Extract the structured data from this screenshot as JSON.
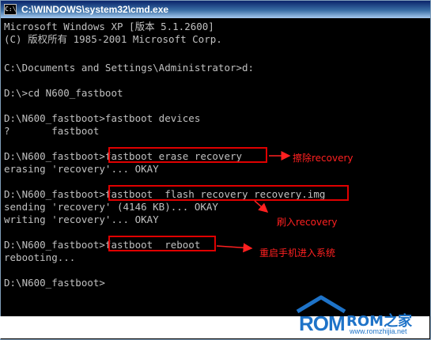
{
  "window": {
    "title": "C:\\WINDOWS\\system32\\cmd.exe",
    "icon": "console-icon",
    "icon_text": "C:\\"
  },
  "console": {
    "lines": [
      "Microsoft Windows XP [版本 5.1.2600]",
      "(C) 版权所有 1985-2001 Microsoft Corp.",
      "",
      "C:\\Documents and Settings\\Administrator>d:",
      "",
      "D:\\>cd N600_fastboot",
      "",
      "D:\\N600_fastboot>fastboot devices",
      "?       fastboot",
      "",
      "D:\\N600_fastboot>fastboot erase recovery",
      "erasing 'recovery'... OKAY",
      "",
      "D:\\N600_fastboot>fastboot  flash recovery recovery.img",
      "sending 'recovery' (4146 KB)... OKAY",
      "writing 'recovery'... OKAY",
      "",
      "D:\\N600_fastboot>fastboot  reboot",
      "rebooting...",
      "",
      "D:\\N600_fastboot>"
    ]
  },
  "annotations": [
    {
      "text": "擦除recovery",
      "color": "#ff2020"
    },
    {
      "text": "刷入recovery",
      "color": "#ff2020"
    },
    {
      "text": "重启手机进入系统",
      "color": "#ff2020"
    }
  ],
  "watermark": {
    "logo_text": "ROM",
    "name": "ROM之家",
    "url": "www.romzhijia.net",
    "color": "#1e73c8"
  }
}
